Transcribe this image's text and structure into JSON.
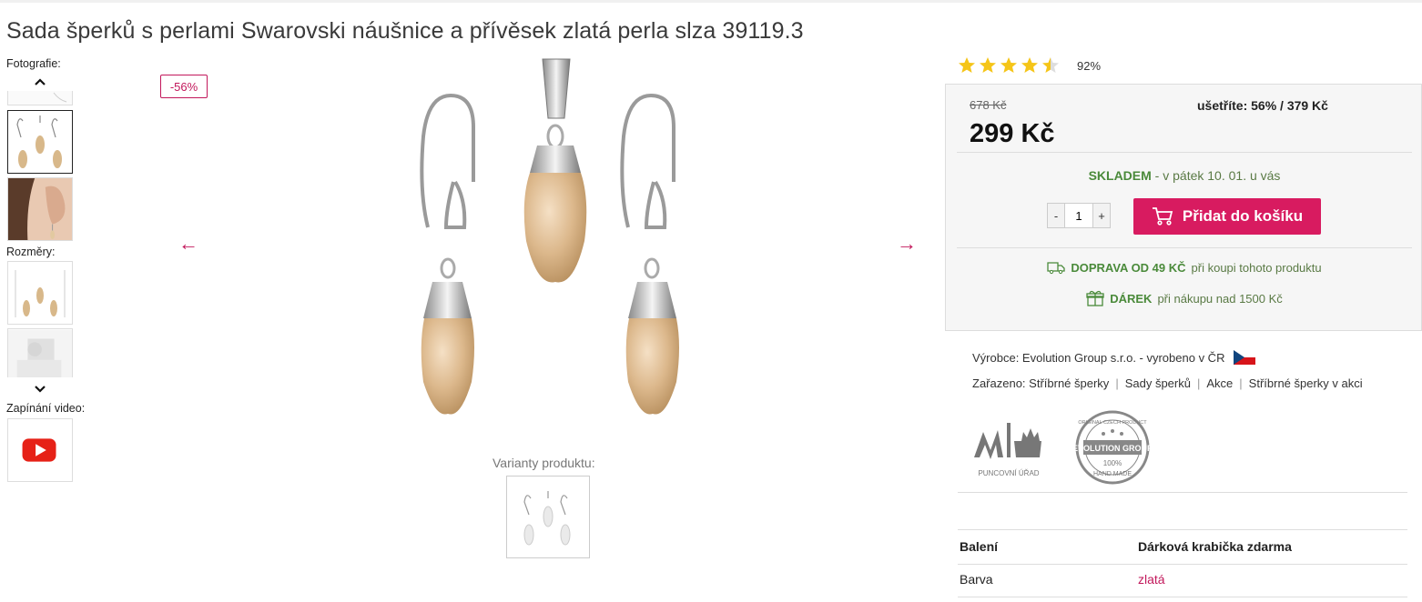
{
  "title": "Sada šperků s perlami Swarovski náušnice a přívěsek zlatá perla slza 39119.3",
  "gallery": {
    "photos_label": "Fotografie:",
    "dimensions_label": "Rozměry:",
    "video_label": "Zapínání video:",
    "icons": [
      "chevron-up-icon",
      "chevron-down-icon",
      "youtube-play-icon"
    ]
  },
  "discount_badge": "-56%",
  "variants_label": "Varianty produktu:",
  "rating": {
    "stars": 4.5,
    "max": 5,
    "percent": "92%"
  },
  "price": {
    "old": "678 Kč",
    "save": "ušetříte: 56% / 379 Kč",
    "current": "299 Kč"
  },
  "stock": {
    "status": "SKLADEM",
    "delivery": " - v pátek 10. 01. u vás"
  },
  "cart": {
    "quantity": "1",
    "minus": "-",
    "plus": "+",
    "add_label": "Přidat do košíku"
  },
  "shipping": {
    "bold": "DOPRAVA OD 49 KČ",
    "rest": "při koupi tohoto produktu"
  },
  "gift": {
    "bold": "DÁREK",
    "rest": "při nákupu nad 1500 Kč"
  },
  "maker": "Výrobce: Evolution Group s.r.o. - vyrobeno v ČR",
  "categories": {
    "label": "Zařazeno: ",
    "items": [
      "Stříbrné šperky",
      "Sady šperků",
      "Akce",
      "Stříbrné šperky v akci"
    ]
  },
  "logos": {
    "puncovni": "PUNCOVNÍ ÚŘAD",
    "evolution_top": "ORIGINAL CZECH PRODUCT",
    "evolution_mid": "EVOLUTION GROUP",
    "evolution_pct": "100%",
    "evolution_bottom": "HAND MADE"
  },
  "specs": [
    {
      "key": "Balení",
      "value": "Dárková krabička zdarma"
    },
    {
      "key": "Barva",
      "value": "zlatá"
    }
  ],
  "colors": {
    "accent": "#d81b60",
    "stock_green": "#4a8a3a",
    "star": "#f5c518"
  }
}
